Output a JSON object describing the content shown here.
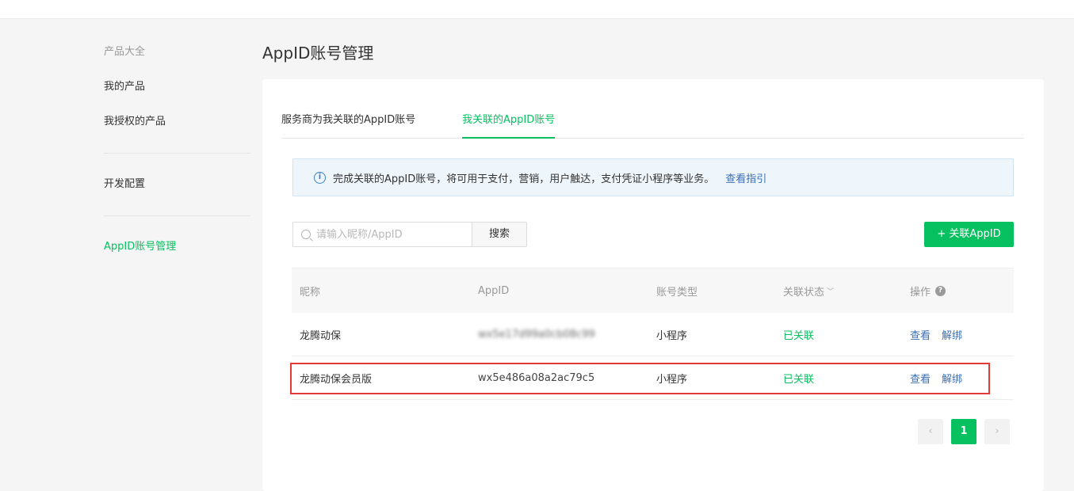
{
  "sidebar": {
    "group_title": "产品大全",
    "items": [
      {
        "label": "我的产品"
      },
      {
        "label": "我授权的产品"
      },
      {
        "label": "开发配置"
      },
      {
        "label": "AppID账号管理"
      }
    ]
  },
  "page_title": "AppID账号管理",
  "tabs": [
    {
      "label": "服务商为我关联的AppID账号"
    },
    {
      "label": "我关联的AppID账号"
    }
  ],
  "notice": {
    "text": "完成关联的AppID账号，将可用于支付，营销，用户触达，支付凭证小程序等业务。",
    "link": "查看指引"
  },
  "search": {
    "placeholder": "请输入昵称/AppID",
    "button_label": "搜索"
  },
  "add_button_label": "+ 关联AppID",
  "table": {
    "headers": {
      "nickname": "昵称",
      "appid": "AppID",
      "type": "账号类型",
      "status": "关联状态",
      "ops": "操作"
    },
    "rows": [
      {
        "nickname": "龙腾动保",
        "appid": "wx5e17d99a0cb08c99",
        "type": "小程序",
        "status": "已关联",
        "view": "查看",
        "unbind": "解绑"
      },
      {
        "nickname": "龙腾动保会员版",
        "appid": "wx5e486a08a2ac79c5",
        "type": "小程序",
        "status": "已关联",
        "view": "查看",
        "unbind": "解绑"
      }
    ]
  },
  "pagination": {
    "prev": "‹",
    "current": "1",
    "next": "›"
  },
  "colors": {
    "accent": "#07c160",
    "link": "#3a6fb5",
    "highlight": "#e53935"
  }
}
